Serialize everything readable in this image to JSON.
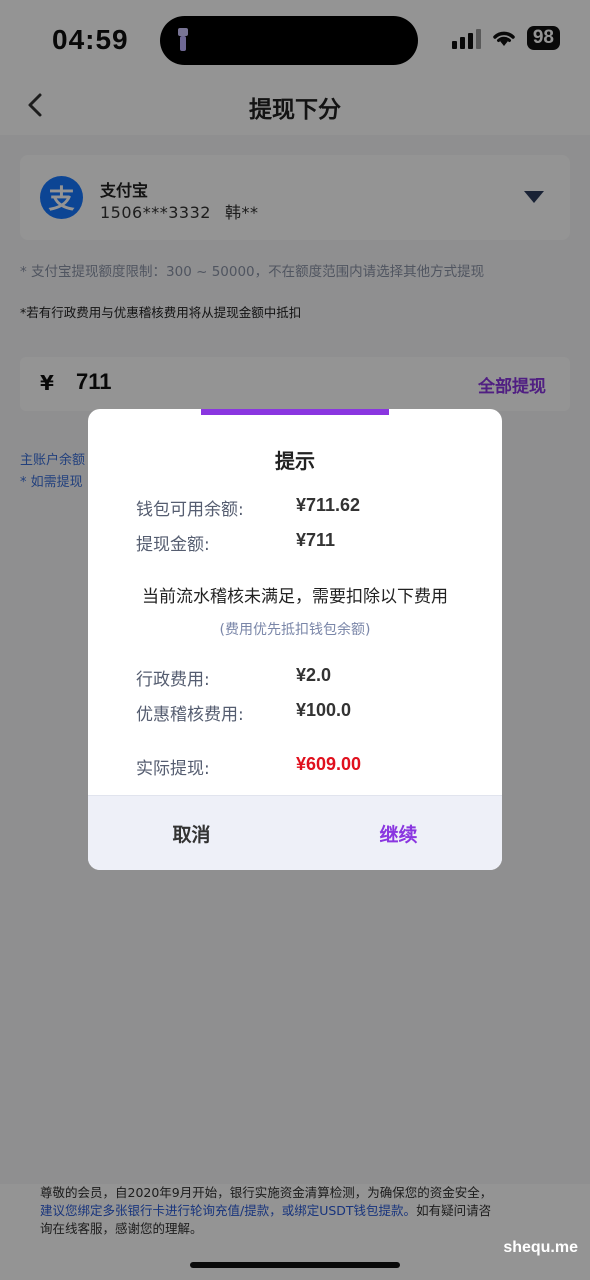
{
  "status_bar": {
    "time": "04:59",
    "battery": "98",
    "icons": [
      "flashlight-icon",
      "signal-icon",
      "wifi-icon",
      "battery-icon"
    ]
  },
  "header": {
    "title": "提现下分",
    "back_icon": "chevron-left-icon"
  },
  "method": {
    "name": "支付宝",
    "logo_text": "支",
    "account": "1506***3332",
    "holder": "韩**",
    "brand_color": "#1677ff"
  },
  "notes": {
    "limit": "* 支付宝提现额度限制：300 ~ 50000，不在额度范围内请选择其他方式提现",
    "fee_notice": "*若有行政费用与优惠稽核费用将从提现金额中抵扣",
    "main_balance": "主账户余额",
    "need_withdraw": "* 如需提现"
  },
  "amount": {
    "currency": "¥",
    "value": "711",
    "withdraw_all": "全部提现"
  },
  "dialog": {
    "title": "提示",
    "wallet_label": "钱包可用余额:",
    "wallet_value": "¥711.62",
    "amount_label": "提现金额:",
    "amount_value": "¥711",
    "message": "当前流水稽核未满足，需要扣除以下费用",
    "sub_message": "(费用优先抵扣钱包余额)",
    "admin_fee_label": "行政费用:",
    "admin_fee_value": "¥2.0",
    "audit_fee_label": "优惠稽核费用:",
    "audit_fee_value": "¥100.0",
    "actual_label": "实际提现:",
    "actual_value": "¥609.00",
    "cancel": "取消",
    "continue": "继续",
    "accent_color": "#8a36e0",
    "highlight_color": "#e0101d"
  },
  "footer": {
    "line1": "尊敬的会员，自2020年9月开始，银行实施资金清算检测，为确保您的资金安全，",
    "line2_link": "建议您绑定多张银行卡进行轮询充值/提款，或绑定USDT钱包提款。",
    "line2_plain": "如有疑问请咨",
    "line3": "询在线客服，感谢您的理解。"
  },
  "watermark": "shequ.me"
}
